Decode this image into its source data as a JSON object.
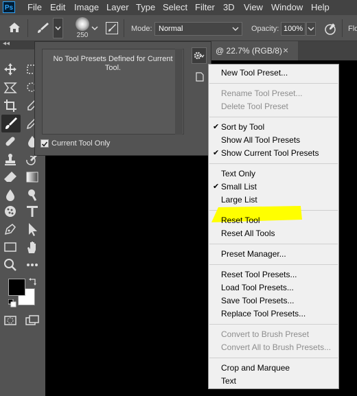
{
  "app": {
    "logo_text": "Ps"
  },
  "menubar": {
    "items": [
      "File",
      "Edit",
      "Image",
      "Layer",
      "Type",
      "Select",
      "Filter",
      "3D",
      "View",
      "Window",
      "Help"
    ]
  },
  "options": {
    "brush_size": "250",
    "mode_label": "Mode:",
    "mode_value": "Normal",
    "opacity_label": "Opacity:",
    "opacity_value": "100%",
    "flow_label": "Flo"
  },
  "document_tab": {
    "title": "@ 22.7% (RGB/8)",
    "close_glyph": "×"
  },
  "preset_panel": {
    "empty_message": "No Tool Presets Defined for Current Tool.",
    "current_tool_only_label": "Current Tool Only",
    "current_tool_only_checked": true
  },
  "menu": {
    "items": [
      {
        "label": "New Tool Preset...",
        "enabled": true,
        "checked": false
      },
      {
        "label": "Rename Tool Preset...",
        "enabled": false,
        "checked": false
      },
      {
        "label": "Delete Tool Preset",
        "enabled": false,
        "checked": false
      },
      {
        "label": "Sort by Tool",
        "enabled": true,
        "checked": true
      },
      {
        "label": "Show All Tool Presets",
        "enabled": true,
        "checked": false
      },
      {
        "label": "Show Current Tool Presets",
        "enabled": true,
        "checked": true
      },
      {
        "label": "Text Only",
        "enabled": true,
        "checked": false
      },
      {
        "label": "Small List",
        "enabled": true,
        "checked": true
      },
      {
        "label": "Large List",
        "enabled": true,
        "checked": false
      },
      {
        "label": "Reset Tool",
        "enabled": true,
        "checked": false,
        "highlighted": true
      },
      {
        "label": "Reset All Tools",
        "enabled": true,
        "checked": false
      },
      {
        "label": "Preset Manager...",
        "enabled": true,
        "checked": false
      },
      {
        "label": "Reset Tool Presets...",
        "enabled": true,
        "checked": false
      },
      {
        "label": "Load Tool Presets...",
        "enabled": true,
        "checked": false
      },
      {
        "label": "Save Tool Presets...",
        "enabled": true,
        "checked": false
      },
      {
        "label": "Replace Tool Presets...",
        "enabled": true,
        "checked": false
      },
      {
        "label": "Convert to Brush Preset",
        "enabled": false,
        "checked": false
      },
      {
        "label": "Convert All to Brush Presets...",
        "enabled": false,
        "checked": false
      },
      {
        "label": "Crop and Marquee",
        "enabled": true,
        "checked": false
      },
      {
        "label": "Text",
        "enabled": true,
        "checked": false
      }
    ],
    "check_glyph": "✔",
    "highlight_color": "#ffff00"
  },
  "colors": {
    "foreground": "#000000",
    "background": "#ffffff"
  }
}
